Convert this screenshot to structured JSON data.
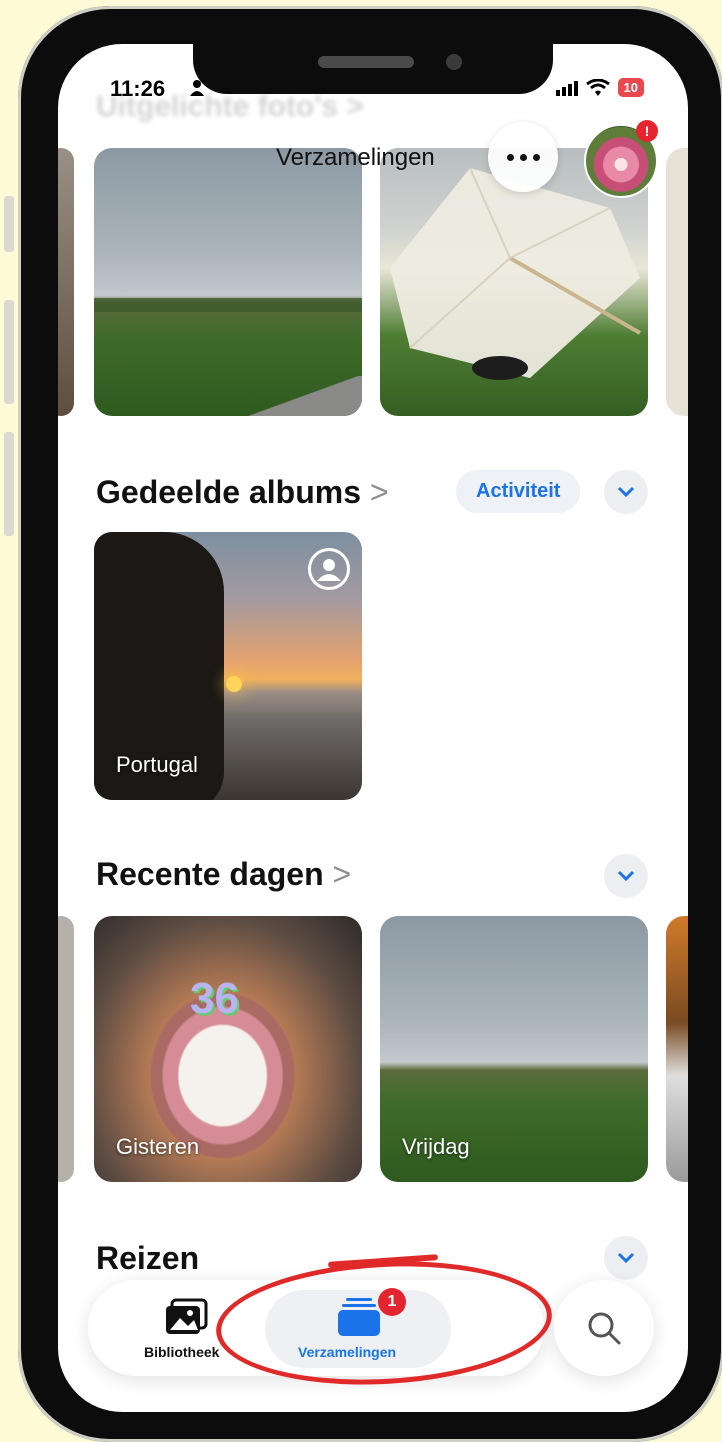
{
  "status_bar": {
    "time": "11:26",
    "battery": "10"
  },
  "header": {
    "faded_title": "Uitgelichte foto's >",
    "title": "Verzamelingen",
    "more_label": "•••",
    "avatar_badge": "!"
  },
  "featured": {
    "items": [
      {
        "icon": "landscape-photo"
      },
      {
        "icon": "umbrella-photo"
      }
    ]
  },
  "shared_albums": {
    "title": "Gedeelde albums",
    "chevron": ">",
    "activity_button": "Activiteit",
    "albums": [
      {
        "label": "Portugal"
      }
    ]
  },
  "recent_days": {
    "title": "Recente dagen",
    "chevron": ">",
    "items": [
      {
        "label": "Gisteren"
      },
      {
        "label": "Vrijdag"
      }
    ],
    "cake_numbers": "36"
  },
  "trips": {
    "title": "Reizen"
  },
  "tabbar": {
    "tabs": [
      {
        "label": "Bibliotheek",
        "icon": "photo-library-icon"
      },
      {
        "label": "Verzamelingen",
        "icon": "collections-icon",
        "badge": "1",
        "active": true
      }
    ],
    "search_icon": "search-icon"
  },
  "colors": {
    "accent": "#1a73e8",
    "badge": "#e4252f",
    "annotation": "#e02a2a",
    "background": "#fdfbd6"
  }
}
